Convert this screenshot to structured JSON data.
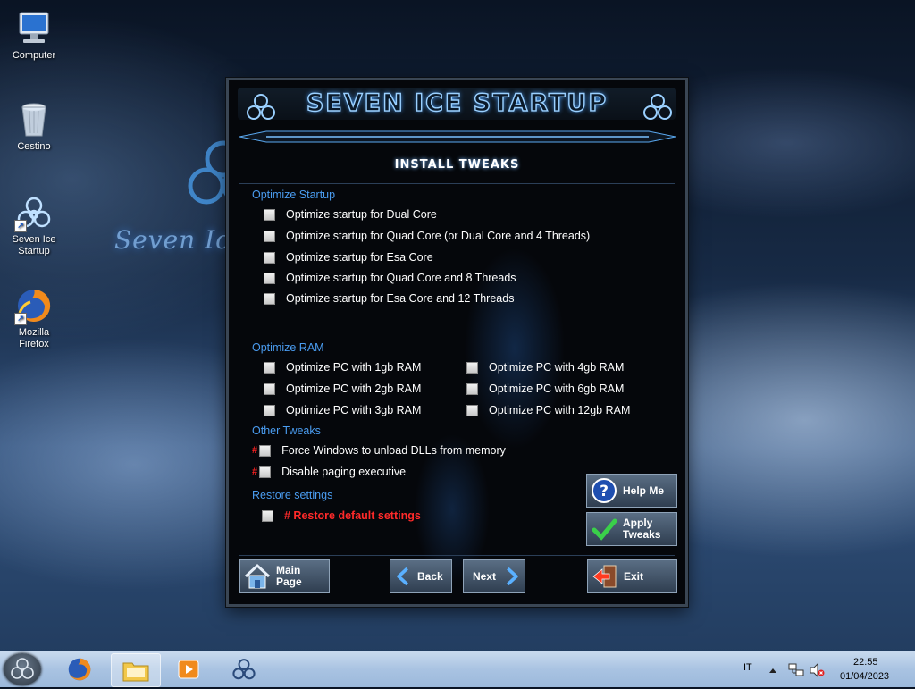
{
  "desktop": {
    "icons": [
      {
        "label": "Computer"
      },
      {
        "label": "Cestino"
      },
      {
        "label_line1": "Seven Ice",
        "label_line2": "Startup"
      },
      {
        "label_line1": "Mozilla",
        "label_line2": "Firefox"
      }
    ],
    "watermark": "Seven Ice"
  },
  "app": {
    "title": "SEVEN ICE STARTUP",
    "section_title": "INSTALL TWEAKS",
    "groups": {
      "startup": {
        "label": "Optimize Startup",
        "options": [
          "Optimize startup for Dual Core",
          "Optimize startup for Quad Core (or Dual Core and 4 Threads)",
          "Optimize startup for Esa Core",
          "Optimize startup for Quad Core and 8 Threads",
          "Optimize startup for Esa Core and 12 Threads"
        ]
      },
      "ram": {
        "label": "Optimize RAM",
        "left": [
          "Optimize PC with 1gb RAM",
          "Optimize PC with 2gb RAM",
          "Optimize PC with 3gb RAM"
        ],
        "right": [
          "Optimize PC with 4gb RAM",
          "Optimize PC with 6gb RAM",
          "Optimize PC with 12gb RAM"
        ]
      },
      "other": {
        "label": "Other Tweaks",
        "marker": "#",
        "options": [
          "Force Windows to unload DLLs from memory",
          "Disable paging executive"
        ]
      },
      "restore": {
        "label": "Restore settings",
        "option": "# Restore default settings"
      }
    },
    "buttons": {
      "help": "Help Me",
      "apply_line1": "Apply",
      "apply_line2": "Tweaks",
      "main_line1": "Main",
      "main_line2": "Page",
      "back": "Back",
      "next": "Next",
      "exit": "Exit"
    }
  },
  "taskbar": {
    "items": [
      "start-orb",
      "firefox-icon",
      "explorer-icon",
      "media-player-icon",
      "seven-ice-icon"
    ],
    "language": "IT",
    "time": "22:55",
    "date": "01/04/2023"
  }
}
